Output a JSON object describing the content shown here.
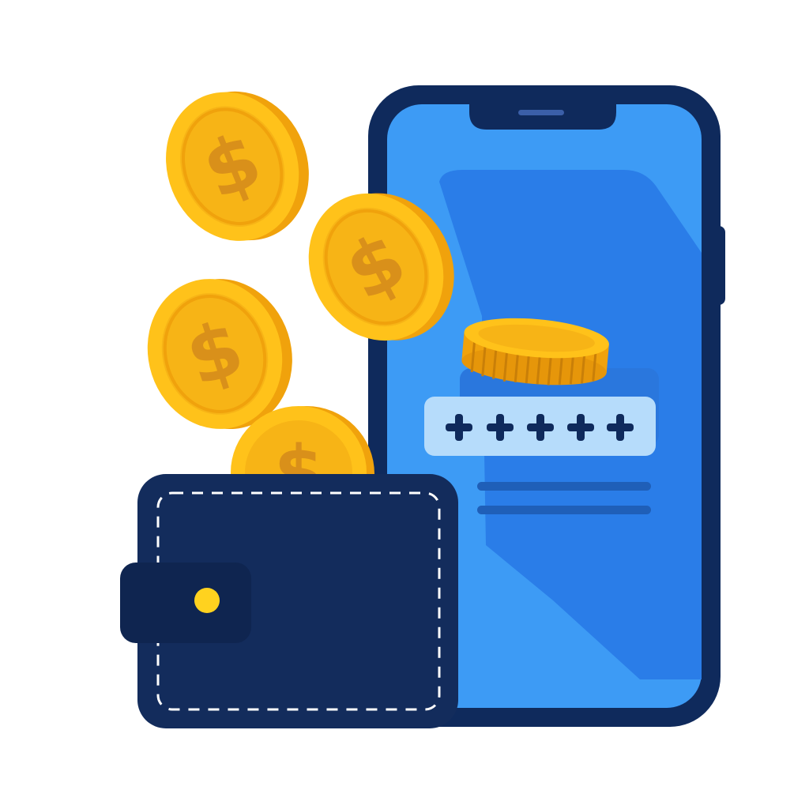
{
  "illustration": {
    "coin_symbol": "$",
    "password_mask": "✚✚✚✚✚",
    "colors": {
      "phone_frame": "#0f2a5c",
      "phone_screen": "#3d9bf5",
      "phone_screen_shade": "#2a7de8",
      "password_field": "#b6dcfb",
      "password_symbols": "#0f2a5c",
      "coin_face": "#ffc21a",
      "coin_rim": "#f0a20c",
      "coin_symbol": "#d9901a",
      "wallet_body": "#132c5c",
      "wallet_flap": "#0f2550",
      "wallet_button": "#ffd21f",
      "stitch": "#ffffff"
    },
    "icons": [
      "coin-icon",
      "wallet-icon",
      "smartphone-icon",
      "password-field-icon"
    ]
  }
}
